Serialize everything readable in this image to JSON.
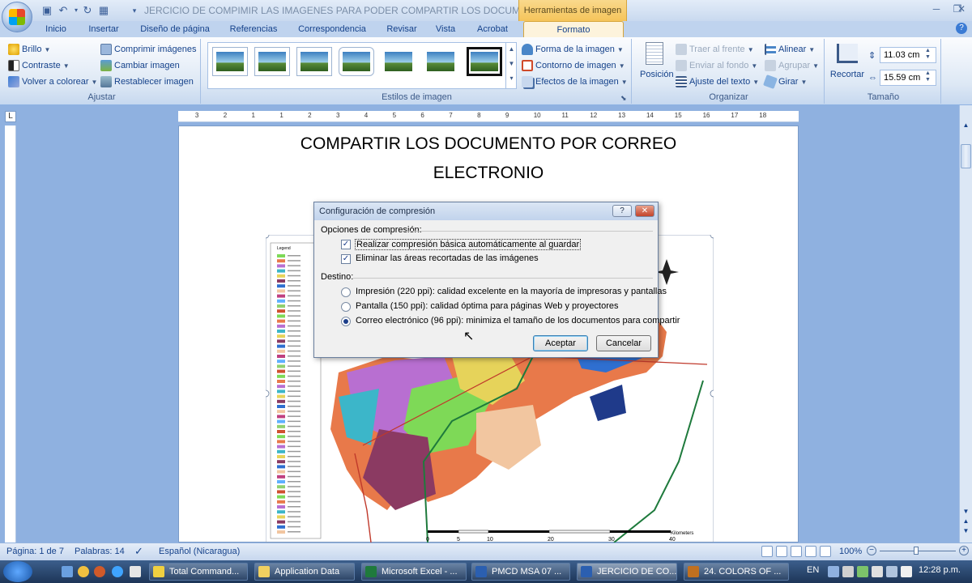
{
  "title_bar": {
    "document_title": "JERCICIO DE COMPIMIR LAS IMAGENES PARA PODER COMPARTIR LOS DOCUMENTO PO...",
    "context_tab": "Herramientas de imagen"
  },
  "tabs": [
    "Inicio",
    "Insertar",
    "Diseño de página",
    "Referencias",
    "Correspondencia",
    "Revisar",
    "Vista",
    "Acrobat",
    "Formato"
  ],
  "ribbon": {
    "ajustar": {
      "label": "Ajustar",
      "brillo": "Brillo",
      "contraste": "Contraste",
      "volver_colorear": "Volver a colorear",
      "comprimir": "Comprimir imágenes",
      "cambiar": "Cambiar imagen",
      "restablecer": "Restablecer imagen"
    },
    "estilos": {
      "label": "Estilos de imagen",
      "forma": "Forma de la imagen",
      "contorno": "Contorno de imagen",
      "efectos": "Efectos de la imagen"
    },
    "organizar": {
      "label": "Organizar",
      "posicion": "Posición",
      "traer": "Traer al frente",
      "enviar": "Enviar al fondo",
      "ajuste_texto": "Ajuste del texto",
      "alinear": "Alinear",
      "agrupar": "Agrupar",
      "girar": "Girar"
    },
    "tamano": {
      "label": "Tamaño",
      "recortar": "Recortar",
      "height": "11.03 cm",
      "width": "15.59 cm"
    }
  },
  "document": {
    "heading_line1": "COMPARTIR LOS DOCUMENTO POR CORREO",
    "heading_line2": "ELECTRONIO",
    "map_legend_title": "Legend",
    "map_scale_unit": "Kilometers",
    "map_scale_ticks": [
      "0",
      "5",
      "10",
      "20",
      "30",
      "40"
    ]
  },
  "dialog": {
    "title": "Configuración de compresión",
    "help_button": "?",
    "close_button": "✕",
    "options_header": "Opciones de compresión:",
    "option1": "Realizar compresión básica automáticamente al guardar",
    "option2": "Eliminar las áreas recortadas de las imágenes",
    "destino_header": "Destino:",
    "radio1": "Impresión (220 ppi): calidad excelente en la mayoría de impresoras y pantallas",
    "radio2": "Pantalla (150 ppi): calidad óptima para páginas Web y proyectores",
    "radio3": "Correo electrónico (96 ppi): minimiza el tamaño de los documentos para compartir",
    "ok": "Aceptar",
    "cancel": "Cancelar"
  },
  "ruler_ticks": [
    "3",
    "2",
    "1",
    "1",
    "2",
    "3",
    "4",
    "5",
    "6",
    "7",
    "8",
    "9",
    "10",
    "11",
    "12",
    "13",
    "14",
    "15",
    "16",
    "17",
    "18"
  ],
  "status": {
    "page": "Página: 1 de 7",
    "words": "Palabras: 14",
    "language": "Español (Nicaragua)",
    "zoom": "100%"
  },
  "taskbar": {
    "items": [
      "Total Command...",
      "Application Data",
      "Microsoft Excel - ...",
      "PMCD MSA 07 ...",
      "JERCICIO DE CO...",
      "24. COLORS OF ..."
    ],
    "lang": "EN",
    "clock": "12:28 p.m."
  },
  "colors": {
    "ribbon_blue": "#15428b",
    "context_orange": "#f5c45a",
    "map_orange": "#e8794a"
  }
}
